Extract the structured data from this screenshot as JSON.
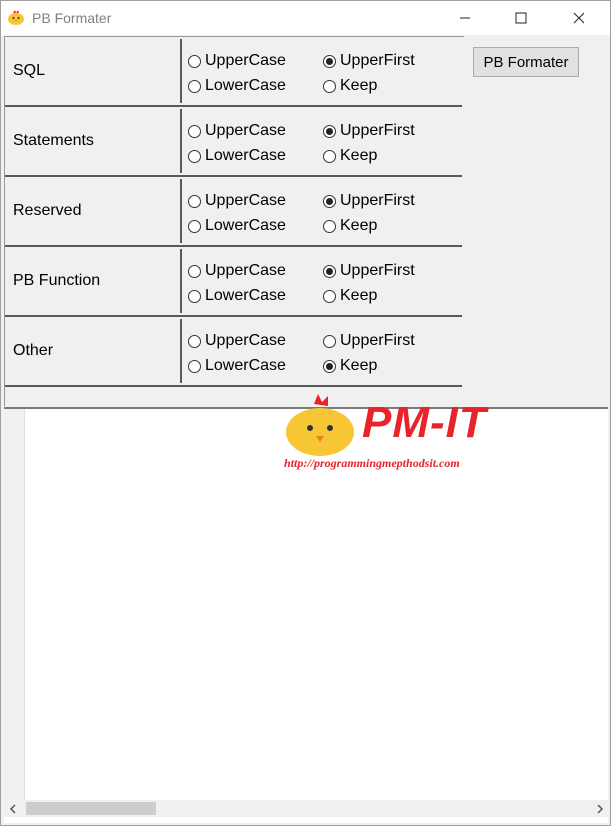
{
  "window": {
    "title": "PB Formater",
    "icon": "chick-icon",
    "controls": [
      "minimize-icon",
      "maximize-icon",
      "close-icon"
    ]
  },
  "options": [
    {
      "label": "SQL",
      "choices": [
        "UpperCase",
        "UpperFirst",
        "LowerCase",
        "Keep"
      ],
      "selected": "UpperFirst"
    },
    {
      "label": "Statements",
      "choices": [
        "UpperCase",
        "UpperFirst",
        "LowerCase",
        "Keep"
      ],
      "selected": "UpperFirst"
    },
    {
      "label": "Reserved",
      "choices": [
        "UpperCase",
        "UpperFirst",
        "LowerCase",
        "Keep"
      ],
      "selected": "UpperFirst"
    },
    {
      "label": "PB Function",
      "choices": [
        "UpperCase",
        "UpperFirst",
        "LowerCase",
        "Keep"
      ],
      "selected": "UpperFirst"
    },
    {
      "label": "Other",
      "choices": [
        "UpperCase",
        "UpperFirst",
        "LowerCase",
        "Keep"
      ],
      "selected": "Keep"
    }
  ],
  "format_button": {
    "label": "PB Formater"
  },
  "editor": {
    "content": ""
  },
  "watermark": {
    "brand": "PM-IT",
    "url": "http://programmingmepthodsit.com",
    "color": "#e8232a"
  },
  "colors": {
    "window_bg": "#f0f0f0",
    "border": "#5a5a5a"
  }
}
